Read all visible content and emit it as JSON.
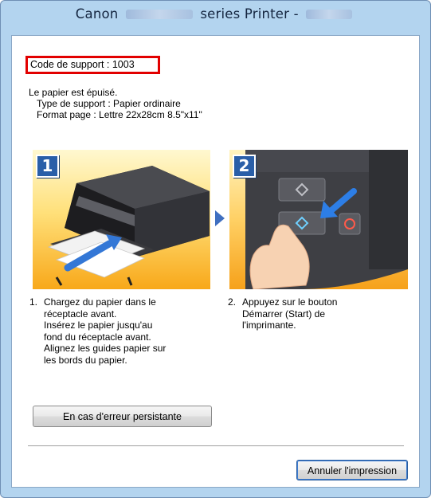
{
  "window": {
    "title_prefix": "Canon",
    "title_middle": "series Printer -"
  },
  "support_code": "Code de support : 1003",
  "message": {
    "line1": "Le papier est épuisé.",
    "line2": "Type de support : Papier ordinaire",
    "line3": "Format page : Lettre 22x28cm 8.5\"x11\""
  },
  "steps": [
    {
      "badge": "1",
      "number": "1.",
      "lines": [
        "Chargez du papier dans le",
        "réceptacle avant.",
        "Insérez le papier jusqu'au",
        "fond du réceptacle avant.",
        "Alignez les guides papier sur",
        "les bords du papier."
      ]
    },
    {
      "badge": "2",
      "number": "2.",
      "lines": [
        "Appuyez sur le bouton",
        "Démarrer (Start) de",
        "l'imprimante."
      ]
    }
  ],
  "buttons": {
    "persistent_error": "En cas d'erreur persistante",
    "cancel_print": "Annuler l'impression"
  },
  "colors": {
    "title_bar": "#b3d4ef",
    "code_border": "#e20000",
    "step_badge": "#2a5fa8",
    "panel_accent": "#f8a81a"
  }
}
